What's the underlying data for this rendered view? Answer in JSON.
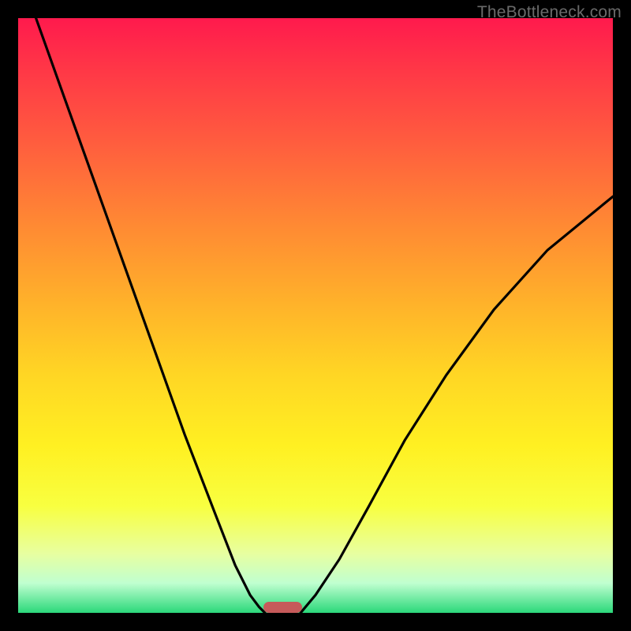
{
  "watermark": "TheBottleneck.com",
  "chart_data": {
    "type": "line",
    "title": "",
    "xlabel": "",
    "ylabel": "",
    "xlim": [
      0,
      1
    ],
    "ylim": [
      0,
      1
    ],
    "grid": false,
    "legend": false,
    "series": [
      {
        "name": "left-curve",
        "x": [
          0.03,
          0.08,
          0.13,
          0.18,
          0.23,
          0.28,
          0.33,
          0.365,
          0.39,
          0.405,
          0.415
        ],
        "y": [
          1.0,
          0.86,
          0.72,
          0.58,
          0.44,
          0.3,
          0.17,
          0.08,
          0.03,
          0.01,
          0.0
        ]
      },
      {
        "name": "right-curve",
        "x": [
          0.475,
          0.5,
          0.54,
          0.59,
          0.65,
          0.72,
          0.8,
          0.89,
          1.0
        ],
        "y": [
          0.0,
          0.03,
          0.09,
          0.18,
          0.29,
          0.4,
          0.51,
          0.61,
          0.7
        ]
      }
    ],
    "optimal_marker": {
      "x_center": 0.445,
      "width": 0.065
    },
    "gradient_stops": [
      {
        "pos": 0.0,
        "color": "#ff1a4d"
      },
      {
        "pos": 0.5,
        "color": "#ffd624"
      },
      {
        "pos": 1.0,
        "color": "#2bd87a"
      }
    ]
  }
}
